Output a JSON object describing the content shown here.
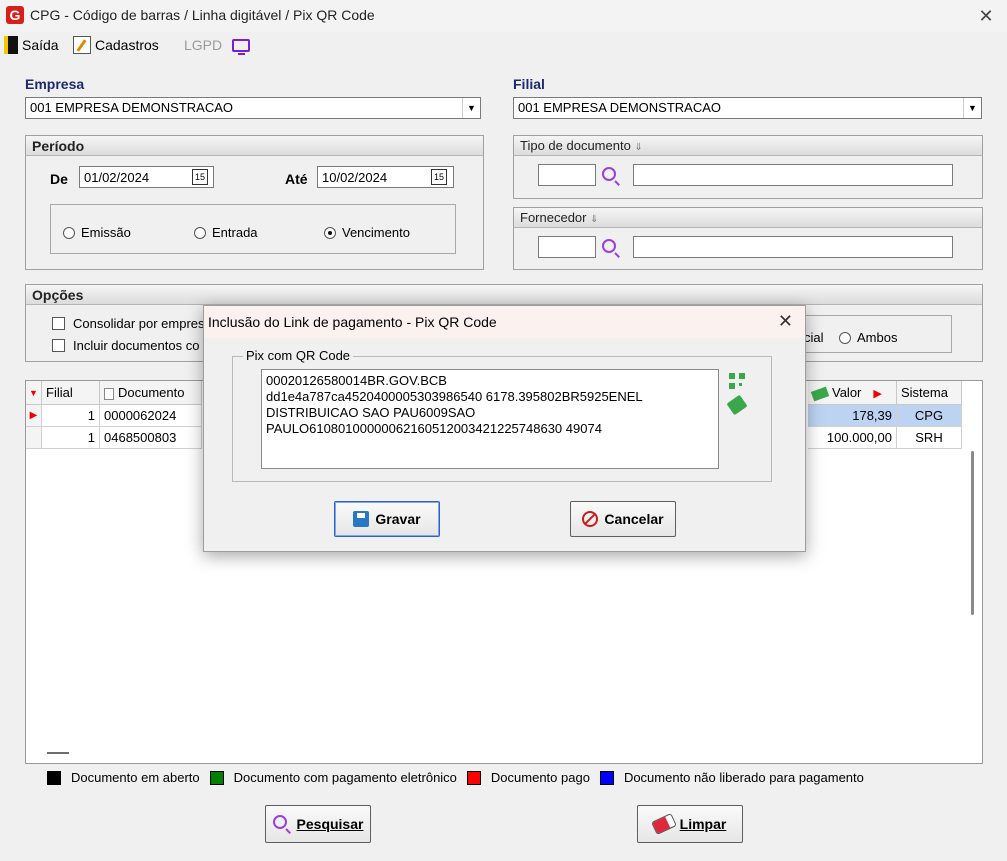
{
  "window": {
    "title": "CPG - Código de barras / Linha digitável / Pix QR Code"
  },
  "toolbar": {
    "exit_label": "Saída",
    "register_label": "Cadastros",
    "lgpd_label": "LGPD"
  },
  "empresa": {
    "label": "Empresa",
    "value": "001 EMPRESA DEMONSTRACAO"
  },
  "filial": {
    "label": "Filial",
    "value": "001 EMPRESA DEMONSTRACAO"
  },
  "periodo": {
    "label": "Período",
    "from_label": "De",
    "from_value": "01/02/2024",
    "to_label": "Até",
    "to_value": "10/02/2024",
    "radios": [
      {
        "label": "Emissão",
        "checked": false
      },
      {
        "label": "Entrada",
        "checked": false
      },
      {
        "label": "Vencimento",
        "checked": true
      }
    ]
  },
  "tipo_documento": {
    "label": "Tipo de documento"
  },
  "fornecedor": {
    "label": "Fornecedor"
  },
  "opcoes": {
    "label": "Opções",
    "check1": "Consolidar por empres",
    "check2": "Incluir documentos co",
    "radio_partial": "cial",
    "radio_both": "Ambos"
  },
  "grid": {
    "headers": [
      "Filial",
      "Documento",
      "Valor",
      "Sistema"
    ],
    "rows": [
      {
        "filial": "1",
        "documento": "0000062024",
        "valor": "178,39",
        "sistema": "CPG"
      },
      {
        "filial": "1",
        "documento": "0468500803",
        "valor": "100.000,00",
        "sistema": "SRH"
      }
    ]
  },
  "legend": [
    {
      "label": "Documento em aberto",
      "color": "#000000"
    },
    {
      "label": "Documento com pagamento eletrônico",
      "color": "#008000"
    },
    {
      "label": "Documento pago",
      "color": "#ff0000"
    },
    {
      "label": "Documento não liberado para pagamento",
      "color": "#0000ff"
    }
  ],
  "buttons": {
    "search": "Pesquisar",
    "clear": "Limpar"
  },
  "modal": {
    "title": "Inclusão do Link de pagamento - Pix QR Code",
    "group_label": "Pix com QR Code",
    "qr_text": "00020126580014BR.GOV.BCB\ndd1e4a787ca4520400005303986540 6178.395802BR5925ENEL\nDISTRIBUICAO SAO PAU6009SAO\nPAULO61080100000062160512003421225748630 49074",
    "save_label": "Gravar",
    "cancel_label": "Cancelar"
  }
}
